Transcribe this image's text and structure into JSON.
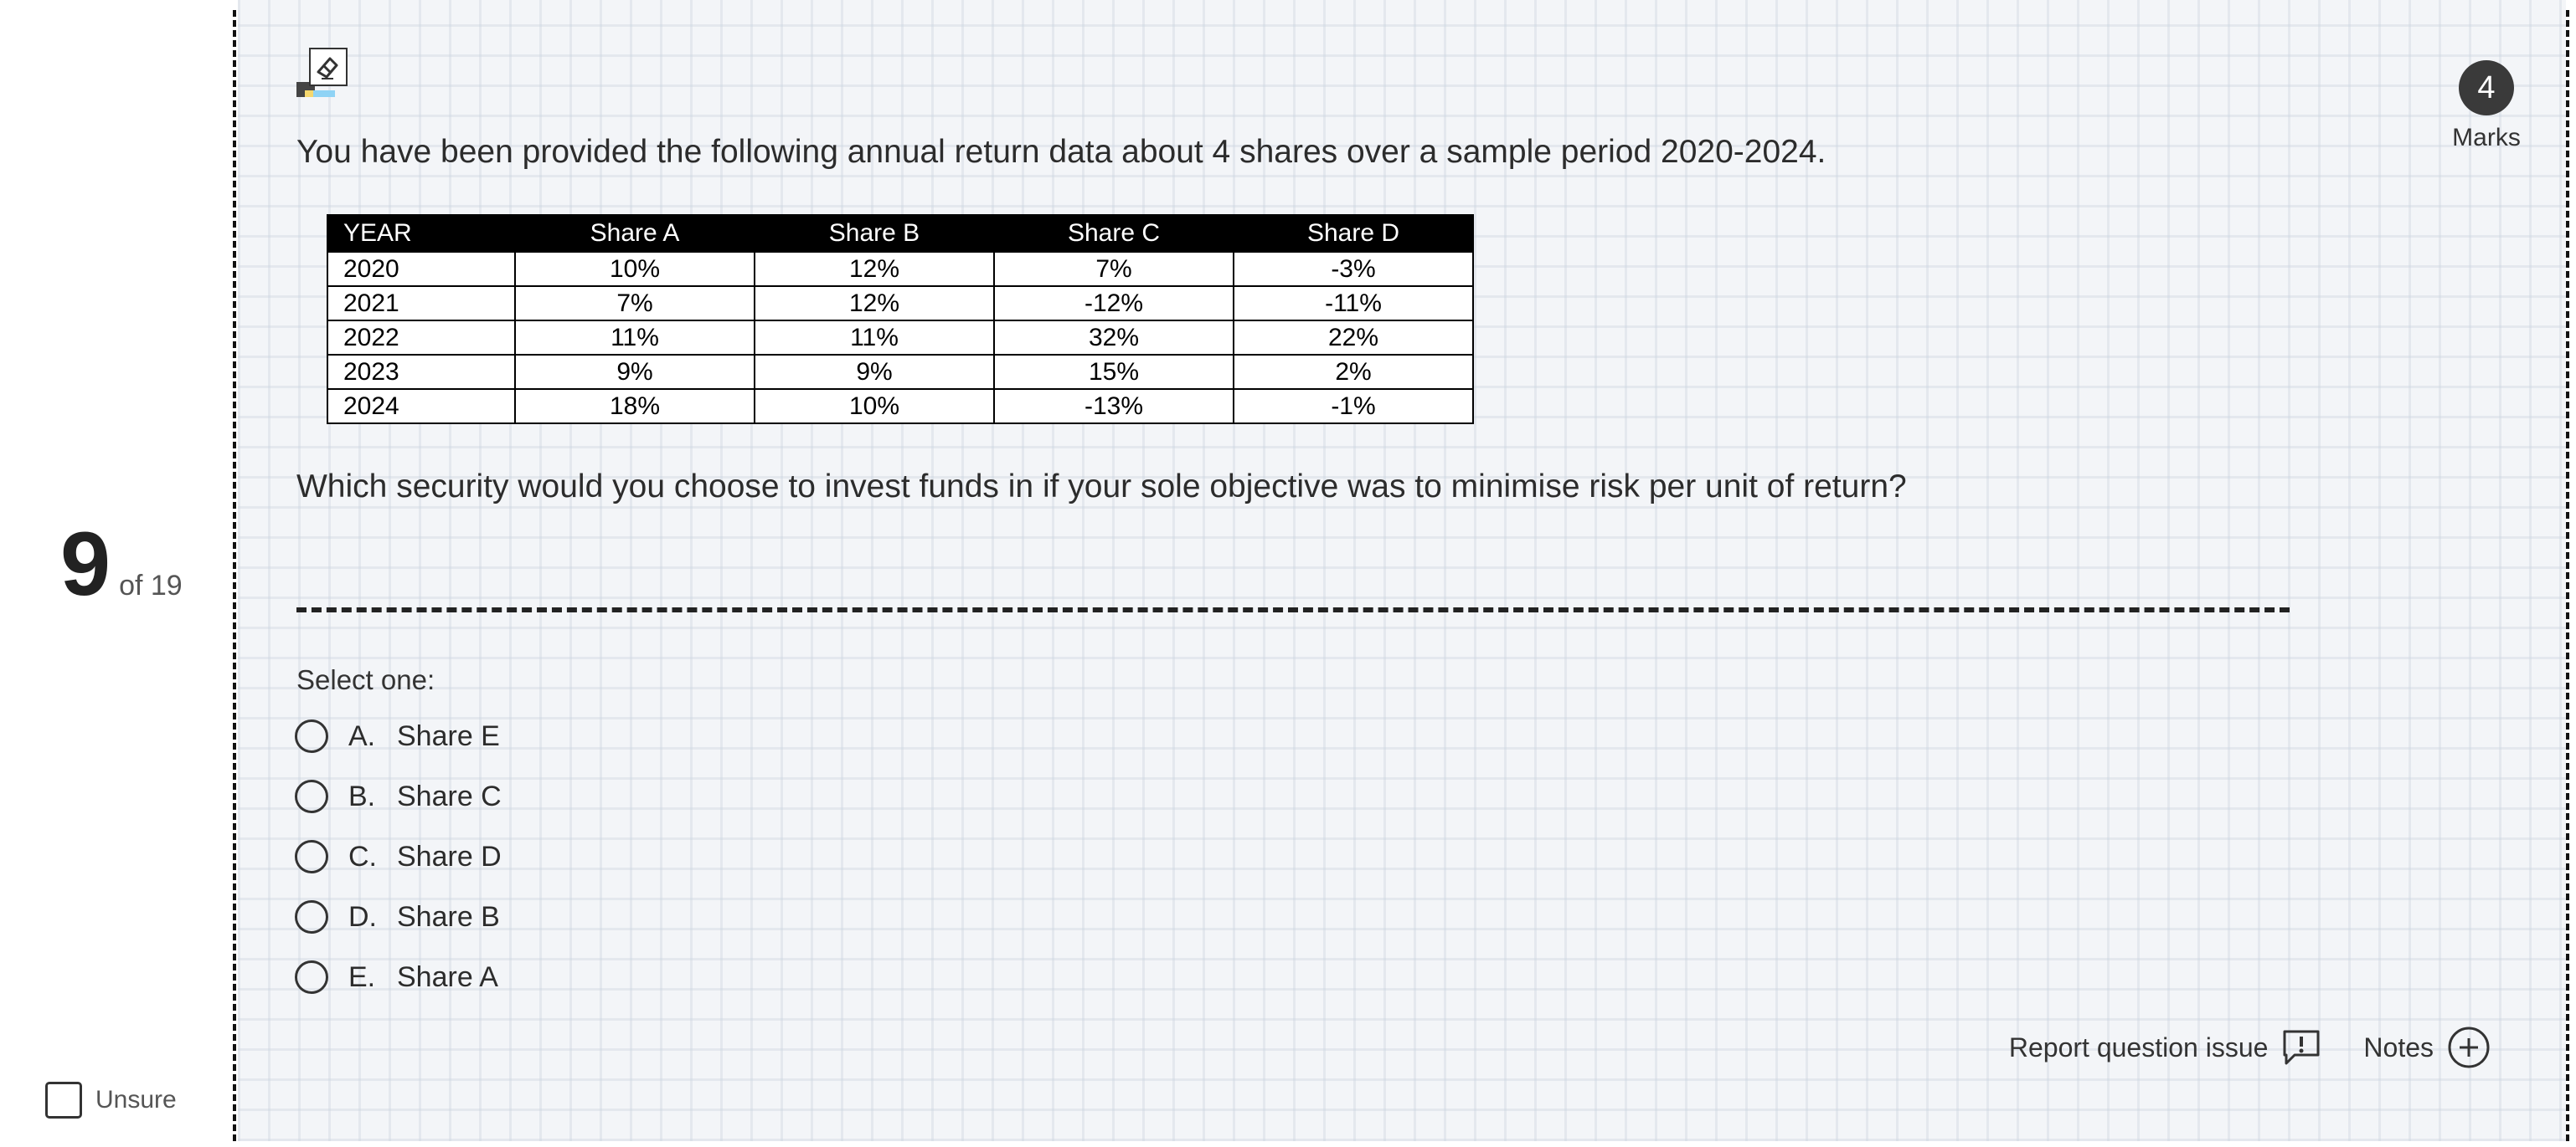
{
  "sidebar": {
    "question_number": "9",
    "question_total": "of 19",
    "unsure_label": "Unsure"
  },
  "marks": {
    "value": "4",
    "label": "Marks"
  },
  "question": {
    "intro": "You have been provided the following annual return data about 4 shares over a sample period 2020-2024.",
    "table": {
      "headers": [
        "YEAR",
        "Share A",
        "Share B",
        "Share C",
        "Share D"
      ],
      "rows": [
        [
          "2020",
          "10%",
          "12%",
          "7%",
          "-3%"
        ],
        [
          "2021",
          "7%",
          "12%",
          "-12%",
          "-11%"
        ],
        [
          "2022",
          "11%",
          "11%",
          "32%",
          "22%"
        ],
        [
          "2023",
          "9%",
          "9%",
          "15%",
          "2%"
        ],
        [
          "2024",
          "18%",
          "10%",
          "-13%",
          "-1%"
        ]
      ]
    },
    "prompt": "Which security would you choose to invest funds in if your sole objective was to minimise risk per unit of return?",
    "select_one": "Select one:",
    "options": [
      {
        "letter": "A.",
        "text": "Share E"
      },
      {
        "letter": "B.",
        "text": "Share C"
      },
      {
        "letter": "C.",
        "text": "Share D"
      },
      {
        "letter": "D.",
        "text": "Share B"
      },
      {
        "letter": "E.",
        "text": "Share A"
      }
    ]
  },
  "footer": {
    "report_label": "Report question issue",
    "notes_label": "Notes"
  },
  "icons": {
    "edit": "eraser-pencil-icon",
    "report": "report-flag-icon",
    "notes": "plus-circle-icon",
    "radio": "radio-icon"
  }
}
